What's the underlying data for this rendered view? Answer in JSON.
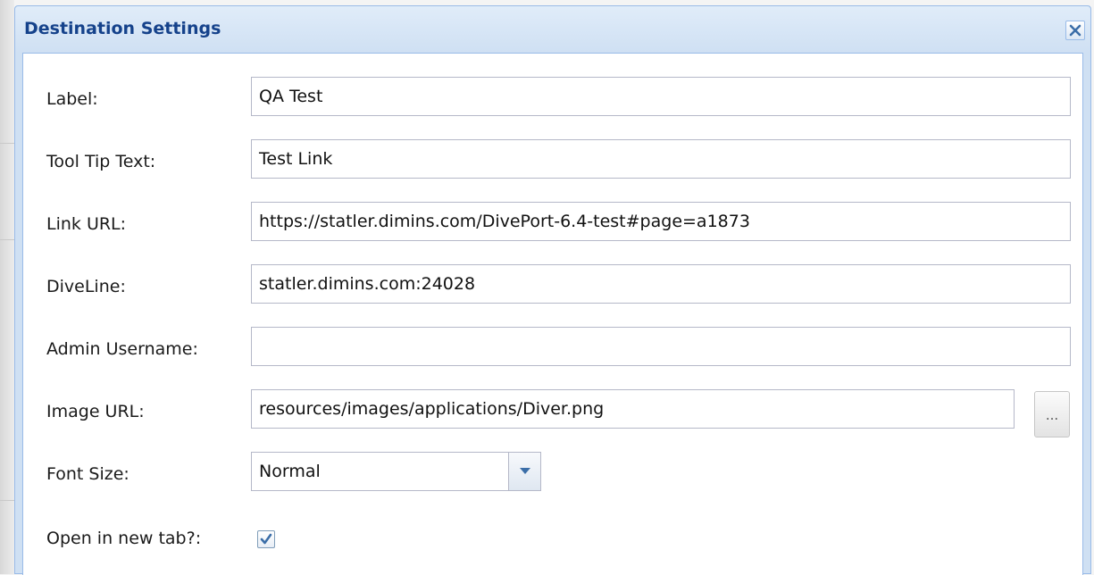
{
  "dialog": {
    "title": "Destination Settings",
    "close_label": "close"
  },
  "fields": {
    "label": {
      "label": "Label:",
      "value": "QA Test"
    },
    "tooltip": {
      "label": "Tool Tip Text:",
      "value": "Test Link"
    },
    "link_url": {
      "label": "Link URL:",
      "value": "https://statler.dimins.com/DivePort-6.4-test#page=a1873"
    },
    "diveline": {
      "label": "DiveLine:",
      "value": "statler.dimins.com:24028"
    },
    "admin_username": {
      "label": "Admin Username:",
      "value": ""
    },
    "image_url": {
      "label": "Image URL:",
      "value": "resources/images/applications/Diver.png",
      "browse_label": "..."
    },
    "font_size": {
      "label": "Font Size:",
      "value": "Normal"
    },
    "open_new_tab": {
      "label": "Open in new tab?:",
      "checked": true
    }
  },
  "colors": {
    "title": "#15428b",
    "header_bg": "#cfe0f3",
    "border": "#99bbe8",
    "check": "#3b6ea8"
  },
  "icons": {
    "close": "close-icon",
    "dropdown": "chevron-down-icon",
    "check": "checkmark-icon"
  }
}
